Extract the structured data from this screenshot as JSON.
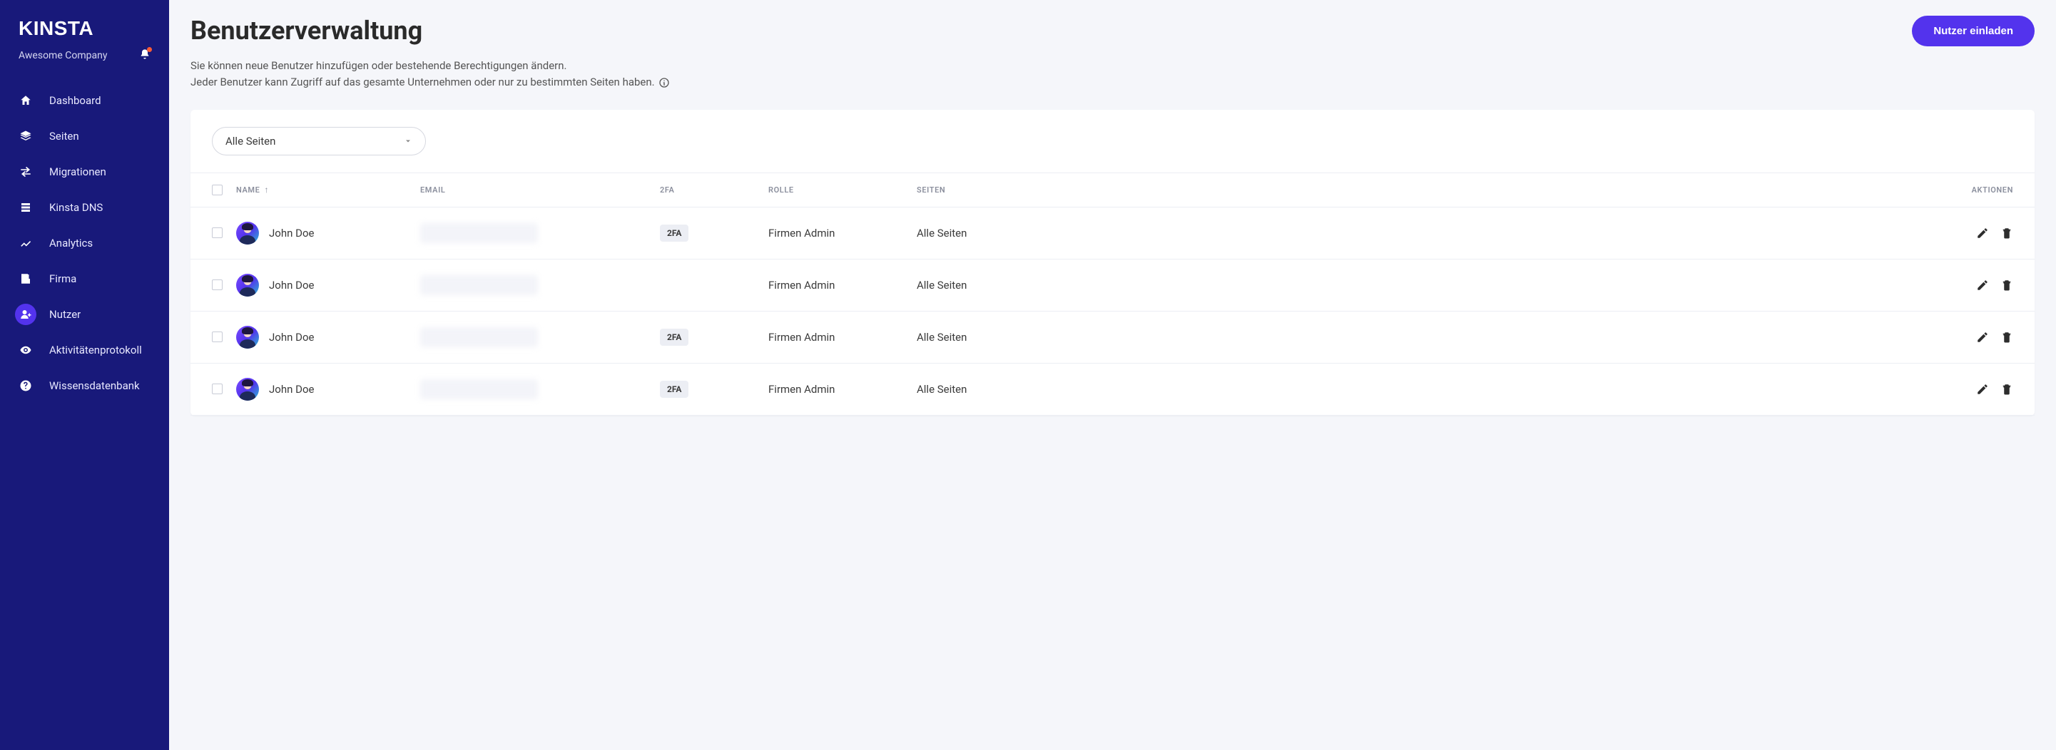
{
  "brand": "KINSTA",
  "company_name": "Awesome Company",
  "sidebar": {
    "items": [
      {
        "label": "Dashboard",
        "icon": "home-icon",
        "active": false
      },
      {
        "label": "Seiten",
        "icon": "layers-icon",
        "active": false
      },
      {
        "label": "Migrationen",
        "icon": "migrate-icon",
        "active": false
      },
      {
        "label": "Kinsta DNS",
        "icon": "dns-icon",
        "active": false
      },
      {
        "label": "Analytics",
        "icon": "trend-icon",
        "active": false
      },
      {
        "label": "Firma",
        "icon": "building-icon",
        "active": false
      },
      {
        "label": "Nutzer",
        "icon": "user-plus-icon",
        "active": true
      },
      {
        "label": "Aktivitätenprotokoll",
        "icon": "eye-icon",
        "active": false
      },
      {
        "label": "Wissensdatenbank",
        "icon": "help-icon",
        "active": false
      }
    ]
  },
  "page": {
    "title": "Benutzerverwaltung",
    "invite_button": "Nutzer einladen",
    "subtitle_line1": "Sie können neue Benutzer hinzufügen oder bestehende Berechtigungen ändern.",
    "subtitle_line2": "Jeder Benutzer kann Zugriff auf das gesamte Unternehmen oder nur zu bestimmten Seiten haben."
  },
  "filter": {
    "selected": "Alle Seiten"
  },
  "table": {
    "columns": {
      "name": "NAME",
      "email": "EMAIL",
      "twofa": "2FA",
      "role": "ROLLE",
      "pages": "SEITEN",
      "actions": "AKTIONEN"
    },
    "sort_indicator": "↑",
    "rows": [
      {
        "name": "John Doe",
        "email": "",
        "twofa": "2FA",
        "has_2fa": true,
        "role": "Firmen Admin",
        "pages": "Alle Seiten"
      },
      {
        "name": "John Doe",
        "email": "",
        "twofa": "",
        "has_2fa": false,
        "role": "Firmen Admin",
        "pages": "Alle Seiten"
      },
      {
        "name": "John Doe",
        "email": "",
        "twofa": "2FA",
        "has_2fa": true,
        "role": "Firmen Admin",
        "pages": "Alle Seiten"
      },
      {
        "name": "John Doe",
        "email": "",
        "twofa": "2FA",
        "has_2fa": true,
        "role": "Firmen Admin",
        "pages": "Alle Seiten"
      }
    ]
  }
}
